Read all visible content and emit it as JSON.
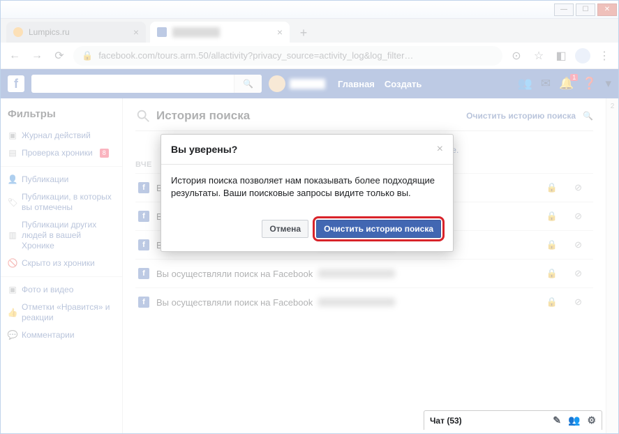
{
  "tabs": [
    {
      "title": "Lumpics.ru",
      "active": false
    },
    {
      "title": "Facebook",
      "active": true
    }
  ],
  "url": "facebook.com/tours.arm.50/allactivity?privacy_source=activity_log&log_filter…",
  "fb": {
    "nav_home": "Главная",
    "nav_create": "Создать",
    "notif_badge": "1"
  },
  "sidebar": {
    "heading": "Фильтры",
    "items": [
      "Журнал действий",
      "Проверка хроники",
      "Публикации",
      "Публикации, в которых вы отмечены",
      "Публикации других людей в вашей Хронике",
      "Скрыто из хроники",
      "Фото и видео",
      "Отметки «Нравится» и реакции",
      "Комментарии"
    ],
    "review_badge": "8"
  },
  "page": {
    "title": "История поиска",
    "clear_link": "Очистить историю поиска",
    "extra_link_tail": "нее.",
    "day_label": "ВЧЕ",
    "row_text": "Вы осуществляли поиск на Facebook",
    "row_first_visible": "В"
  },
  "modal": {
    "title": "Вы уверены?",
    "body": "История поиска позволяет нам показывать более подходящие результаты. Ваши поисковые запросы видите только вы.",
    "cancel": "Отмена",
    "confirm": "Очистить историю поиска"
  },
  "chat": {
    "label": "Чат (53)"
  },
  "right_col": {
    "top": "2"
  }
}
